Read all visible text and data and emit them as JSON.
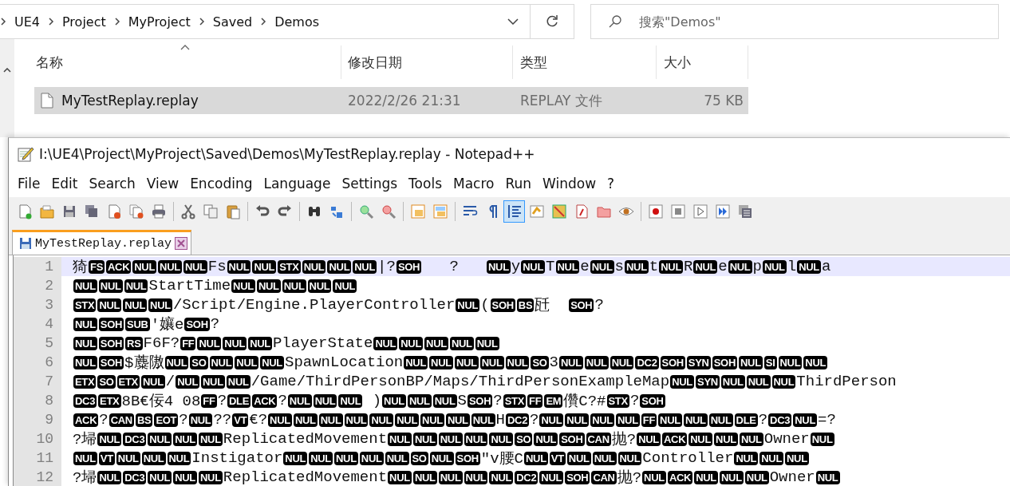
{
  "explorer": {
    "breadcrumbs": [
      "UE4",
      "Project",
      "MyProject",
      "Saved",
      "Demos"
    ],
    "search": {
      "placeholder": "搜索\"Demos\""
    },
    "columns": [
      {
        "label": "名称",
        "sorted": true
      },
      {
        "label": "修改日期",
        "sorted": false
      },
      {
        "label": "类型",
        "sorted": false
      },
      {
        "label": "大小",
        "sorted": false
      }
    ],
    "files": [
      {
        "name": "MyTestReplay.replay",
        "modified": "2022/2/26 21:31",
        "type": "REPLAY 文件",
        "size": "75 KB",
        "selected": true
      }
    ]
  },
  "notepad": {
    "title": "I:\\UE4\\Project\\MyProject\\Saved\\Demos\\MyTestReplay.replay - Notepad++",
    "menu": [
      "File",
      "Edit",
      "Search",
      "View",
      "Encoding",
      "Language",
      "Settings",
      "Tools",
      "Macro",
      "Run",
      "Window",
      "?"
    ],
    "toolbar": [
      {
        "buttons": [
          {
            "on": false
          },
          {
            "on": false
          },
          {
            "on": false
          },
          {
            "on": false
          },
          {
            "on": false
          },
          {
            "on": false
          },
          {
            "on": false
          }
        ]
      },
      {
        "buttons": [
          {
            "on": false
          },
          {
            "on": false
          },
          {
            "on": false
          }
        ]
      },
      {
        "buttons": [
          {
            "on": false
          },
          {
            "on": false
          }
        ]
      },
      {
        "buttons": [
          {
            "on": false
          },
          {
            "on": false
          }
        ]
      },
      {
        "buttons": [
          {
            "on": false
          },
          {
            "on": false
          }
        ]
      },
      {
        "buttons": [
          {
            "on": false
          },
          {
            "on": false
          }
        ]
      },
      {
        "buttons": [
          {
            "on": false
          },
          {
            "on": false
          },
          {
            "on": true
          },
          {
            "on": false
          },
          {
            "on": false
          },
          {
            "on": false
          },
          {
            "on": false
          },
          {
            "on": false
          }
        ]
      },
      {
        "buttons": [
          {
            "on": false
          },
          {
            "on": false
          },
          {
            "on": false
          },
          {
            "on": false
          },
          {
            "on": false
          }
        ]
      }
    ],
    "tabs": [
      {
        "label": "MyTestReplay.replay",
        "selected": true
      }
    ],
    "lines": [
      {
        "number": "1",
        "current": true,
        "segments": [
          {
            "kind": "text",
            "text": "猗"
          },
          {
            "kind": "ctrl",
            "text": "FS"
          },
          {
            "kind": "ctrl",
            "text": "ACK"
          },
          {
            "kind": "ctrl",
            "text": "NUL"
          },
          {
            "kind": "ctrl",
            "text": "NUL"
          },
          {
            "kind": "ctrl",
            "text": "NUL"
          },
          {
            "kind": "text",
            "text": "Fs"
          },
          {
            "kind": "ctrl",
            "text": "NUL"
          },
          {
            "kind": "ctrl",
            "text": "NUL"
          },
          {
            "kind": "ctrl",
            "text": "STX"
          },
          {
            "kind": "ctrl",
            "text": "NUL"
          },
          {
            "kind": "ctrl",
            "text": "NUL"
          },
          {
            "kind": "ctrl",
            "text": "NUL"
          },
          {
            "kind": "text",
            "text": "|?"
          },
          {
            "kind": "ctrl",
            "text": "SOH"
          },
          {
            "kind": "text",
            "text": "   ?   "
          },
          {
            "kind": "ctrl",
            "text": "NUL"
          },
          {
            "kind": "text",
            "text": "y"
          },
          {
            "kind": "ctrl",
            "text": "NUL"
          },
          {
            "kind": "text",
            "text": "T"
          },
          {
            "kind": "ctrl",
            "text": "NUL"
          },
          {
            "kind": "text",
            "text": "e"
          },
          {
            "kind": "ctrl",
            "text": "NUL"
          },
          {
            "kind": "text",
            "text": "s"
          },
          {
            "kind": "ctrl",
            "text": "NUL"
          },
          {
            "kind": "text",
            "text": "t"
          },
          {
            "kind": "ctrl",
            "text": "NUL"
          },
          {
            "kind": "text",
            "text": "R"
          },
          {
            "kind": "ctrl",
            "text": "NUL"
          },
          {
            "kind": "text",
            "text": "e"
          },
          {
            "kind": "ctrl",
            "text": "NUL"
          },
          {
            "kind": "text",
            "text": "p"
          },
          {
            "kind": "ctrl",
            "text": "NUL"
          },
          {
            "kind": "text",
            "text": "l"
          },
          {
            "kind": "ctrl",
            "text": "NUL"
          },
          {
            "kind": "text",
            "text": "a"
          }
        ]
      },
      {
        "number": "2",
        "current": false,
        "segments": [
          {
            "kind": "ctrl",
            "text": "NUL"
          },
          {
            "kind": "ctrl",
            "text": "NUL"
          },
          {
            "kind": "ctrl",
            "text": "NUL"
          },
          {
            "kind": "text",
            "text": "StartTime"
          },
          {
            "kind": "ctrl",
            "text": "NUL"
          },
          {
            "kind": "ctrl",
            "text": "NUL"
          },
          {
            "kind": "ctrl",
            "text": "NUL"
          },
          {
            "kind": "ctrl",
            "text": "NUL"
          },
          {
            "kind": "ctrl",
            "text": "NUL"
          }
        ]
      },
      {
        "number": "3",
        "current": false,
        "segments": [
          {
            "kind": "ctrl",
            "text": "STX"
          },
          {
            "kind": "ctrl",
            "text": "NUL"
          },
          {
            "kind": "ctrl",
            "text": "NUL"
          },
          {
            "kind": "ctrl",
            "text": "NUL"
          },
          {
            "kind": "text",
            "text": "/Script/Engine.PlayerController"
          },
          {
            "kind": "ctrl",
            "text": "NUL"
          },
          {
            "kind": "text",
            "text": "("
          },
          {
            "kind": "ctrl",
            "text": "SOH"
          },
          {
            "kind": "ctrl",
            "text": "BS"
          },
          {
            "kind": "text",
            "text": "瓩  "
          },
          {
            "kind": "ctrl",
            "text": "SOH"
          },
          {
            "kind": "text",
            "text": "?"
          }
        ]
      },
      {
        "number": "4",
        "current": false,
        "segments": [
          {
            "kind": "ctrl",
            "text": "NUL"
          },
          {
            "kind": "ctrl",
            "text": "SOH"
          },
          {
            "kind": "ctrl",
            "text": "SUB"
          },
          {
            "kind": "text",
            "text": "'孃e"
          },
          {
            "kind": "ctrl",
            "text": "SOH"
          },
          {
            "kind": "text",
            "text": "?"
          }
        ]
      },
      {
        "number": "5",
        "current": false,
        "segments": [
          {
            "kind": "ctrl",
            "text": "NUL"
          },
          {
            "kind": "ctrl",
            "text": "SOH"
          },
          {
            "kind": "ctrl",
            "text": "RS"
          },
          {
            "kind": "text",
            "text": "F6F?"
          },
          {
            "kind": "ctrl",
            "text": "FF"
          },
          {
            "kind": "ctrl",
            "text": "NUL"
          },
          {
            "kind": "ctrl",
            "text": "NUL"
          },
          {
            "kind": "ctrl",
            "text": "NUL"
          },
          {
            "kind": "text",
            "text": "PlayerState"
          },
          {
            "kind": "ctrl",
            "text": "NUL"
          },
          {
            "kind": "ctrl",
            "text": "NUL"
          },
          {
            "kind": "ctrl",
            "text": "NUL"
          },
          {
            "kind": "ctrl",
            "text": "NUL"
          },
          {
            "kind": "ctrl",
            "text": "NUL"
          }
        ]
      },
      {
        "number": "6",
        "current": false,
        "segments": [
          {
            "kind": "ctrl",
            "text": "NUL"
          },
          {
            "kind": "ctrl",
            "text": "SOH"
          },
          {
            "kind": "text",
            "text": "$蘪隞"
          },
          {
            "kind": "ctrl",
            "text": "NUL"
          },
          {
            "kind": "ctrl",
            "text": "SO"
          },
          {
            "kind": "ctrl",
            "text": "NUL"
          },
          {
            "kind": "ctrl",
            "text": "NUL"
          },
          {
            "kind": "ctrl",
            "text": "NUL"
          },
          {
            "kind": "text",
            "text": "SpawnLocation"
          },
          {
            "kind": "ctrl",
            "text": "NUL"
          },
          {
            "kind": "ctrl",
            "text": "NUL"
          },
          {
            "kind": "ctrl",
            "text": "NUL"
          },
          {
            "kind": "ctrl",
            "text": "NUL"
          },
          {
            "kind": "ctrl",
            "text": "NUL"
          },
          {
            "kind": "ctrl",
            "text": "SO"
          },
          {
            "kind": "text",
            "text": "3"
          },
          {
            "kind": "ctrl",
            "text": "NUL"
          },
          {
            "kind": "ctrl",
            "text": "NUL"
          },
          {
            "kind": "ctrl",
            "text": "NUL"
          },
          {
            "kind": "ctrl",
            "text": "DC2"
          },
          {
            "kind": "ctrl",
            "text": "SOH"
          },
          {
            "kind": "ctrl",
            "text": "SYN"
          },
          {
            "kind": "ctrl",
            "text": "SOH"
          },
          {
            "kind": "ctrl",
            "text": "NUL"
          },
          {
            "kind": "ctrl",
            "text": "SI"
          },
          {
            "kind": "ctrl",
            "text": "NUL"
          },
          {
            "kind": "ctrl",
            "text": "NUL"
          }
        ]
      },
      {
        "number": "7",
        "current": false,
        "segments": [
          {
            "kind": "ctrl",
            "text": "ETX"
          },
          {
            "kind": "ctrl",
            "text": "SO"
          },
          {
            "kind": "ctrl",
            "text": "ETX"
          },
          {
            "kind": "ctrl",
            "text": "NUL"
          },
          {
            "kind": "text",
            "text": "/"
          },
          {
            "kind": "ctrl",
            "text": "NUL"
          },
          {
            "kind": "ctrl",
            "text": "NUL"
          },
          {
            "kind": "ctrl",
            "text": "NUL"
          },
          {
            "kind": "text",
            "text": "/Game/ThirdPersonBP/Maps/ThirdPersonExampleMap"
          },
          {
            "kind": "ctrl",
            "text": "NUL"
          },
          {
            "kind": "ctrl",
            "text": "SYN"
          },
          {
            "kind": "ctrl",
            "text": "NUL"
          },
          {
            "kind": "ctrl",
            "text": "NUL"
          },
          {
            "kind": "ctrl",
            "text": "NUL"
          },
          {
            "kind": "text",
            "text": "ThirdPerson"
          }
        ]
      },
      {
        "number": "8",
        "current": false,
        "segments": [
          {
            "kind": "ctrl",
            "text": "DC3"
          },
          {
            "kind": "ctrl",
            "text": "ETX"
          },
          {
            "kind": "text",
            "text": "8B€佞4 08"
          },
          {
            "kind": "ctrl",
            "text": "FF"
          },
          {
            "kind": "text",
            "text": "?"
          },
          {
            "kind": "ctrl",
            "text": "DLE"
          },
          {
            "kind": "ctrl",
            "text": "ACK"
          },
          {
            "kind": "text",
            "text": "?"
          },
          {
            "kind": "ctrl",
            "text": "NUL"
          },
          {
            "kind": "ctrl",
            "text": "NUL"
          },
          {
            "kind": "ctrl",
            "text": "NUL"
          },
          {
            "kind": "text",
            "text": " )"
          },
          {
            "kind": "ctrl",
            "text": "NUL"
          },
          {
            "kind": "ctrl",
            "text": "NUL"
          },
          {
            "kind": "ctrl",
            "text": "NUL"
          },
          {
            "kind": "text",
            "text": "S"
          },
          {
            "kind": "ctrl",
            "text": "SOH"
          },
          {
            "kind": "text",
            "text": "?"
          },
          {
            "kind": "ctrl",
            "text": "STX"
          },
          {
            "kind": "ctrl",
            "text": "FF"
          },
          {
            "kind": "ctrl",
            "text": "EM"
          },
          {
            "kind": "text",
            "text": "儹C?#"
          },
          {
            "kind": "ctrl",
            "text": "STX"
          },
          {
            "kind": "text",
            "text": "?"
          },
          {
            "kind": "ctrl",
            "text": "SOH"
          }
        ]
      },
      {
        "number": "9",
        "current": false,
        "segments": [
          {
            "kind": "ctrl",
            "text": "ACK"
          },
          {
            "kind": "text",
            "text": "?"
          },
          {
            "kind": "ctrl",
            "text": "CAN"
          },
          {
            "kind": "ctrl",
            "text": "BS"
          },
          {
            "kind": "ctrl",
            "text": "EOT"
          },
          {
            "kind": "text",
            "text": "?"
          },
          {
            "kind": "ctrl",
            "text": "NUL"
          },
          {
            "kind": "text",
            "text": "??"
          },
          {
            "kind": "ctrl",
            "text": "VT"
          },
          {
            "kind": "text",
            "text": "€?"
          },
          {
            "kind": "ctrl",
            "text": "NUL"
          },
          {
            "kind": "ctrl",
            "text": "NUL"
          },
          {
            "kind": "ctrl",
            "text": "NUL"
          },
          {
            "kind": "ctrl",
            "text": "NUL"
          },
          {
            "kind": "ctrl",
            "text": "NUL"
          },
          {
            "kind": "ctrl",
            "text": "NUL"
          },
          {
            "kind": "ctrl",
            "text": "NUL"
          },
          {
            "kind": "ctrl",
            "text": "NUL"
          },
          {
            "kind": "ctrl",
            "text": "NUL"
          },
          {
            "kind": "text",
            "text": "H"
          },
          {
            "kind": "ctrl",
            "text": "DC2"
          },
          {
            "kind": "text",
            "text": "?"
          },
          {
            "kind": "ctrl",
            "text": "NUL"
          },
          {
            "kind": "ctrl",
            "text": "NUL"
          },
          {
            "kind": "ctrl",
            "text": "NUL"
          },
          {
            "kind": "ctrl",
            "text": "NUL"
          },
          {
            "kind": "ctrl",
            "text": "FF"
          },
          {
            "kind": "ctrl",
            "text": "NUL"
          },
          {
            "kind": "ctrl",
            "text": "NUL"
          },
          {
            "kind": "ctrl",
            "text": "NUL"
          },
          {
            "kind": "ctrl",
            "text": "DLE"
          },
          {
            "kind": "text",
            "text": "?"
          },
          {
            "kind": "ctrl",
            "text": "DC3"
          },
          {
            "kind": "ctrl",
            "text": "NUL"
          },
          {
            "kind": "text",
            "text": "=?"
          }
        ]
      },
      {
        "number": "10",
        "current": false,
        "segments": [
          {
            "kind": "text",
            "text": "?埽"
          },
          {
            "kind": "ctrl",
            "text": "NUL"
          },
          {
            "kind": "ctrl",
            "text": "DC3"
          },
          {
            "kind": "ctrl",
            "text": "NUL"
          },
          {
            "kind": "ctrl",
            "text": "NUL"
          },
          {
            "kind": "ctrl",
            "text": "NUL"
          },
          {
            "kind": "text",
            "text": "ReplicatedMovement"
          },
          {
            "kind": "ctrl",
            "text": "NUL"
          },
          {
            "kind": "ctrl",
            "text": "NUL"
          },
          {
            "kind": "ctrl",
            "text": "NUL"
          },
          {
            "kind": "ctrl",
            "text": "NUL"
          },
          {
            "kind": "ctrl",
            "text": "NUL"
          },
          {
            "kind": "ctrl",
            "text": "SO"
          },
          {
            "kind": "ctrl",
            "text": "NUL"
          },
          {
            "kind": "ctrl",
            "text": "SOH"
          },
          {
            "kind": "ctrl",
            "text": "CAN"
          },
          {
            "kind": "text",
            "text": "抛?"
          },
          {
            "kind": "ctrl",
            "text": "NUL"
          },
          {
            "kind": "ctrl",
            "text": "ACK"
          },
          {
            "kind": "ctrl",
            "text": "NUL"
          },
          {
            "kind": "ctrl",
            "text": "NUL"
          },
          {
            "kind": "ctrl",
            "text": "NUL"
          },
          {
            "kind": "text",
            "text": "Owner"
          },
          {
            "kind": "ctrl",
            "text": "NUL"
          }
        ]
      },
      {
        "number": "11",
        "current": false,
        "segments": [
          {
            "kind": "ctrl",
            "text": "NUL"
          },
          {
            "kind": "ctrl",
            "text": "VT"
          },
          {
            "kind": "ctrl",
            "text": "NUL"
          },
          {
            "kind": "ctrl",
            "text": "NUL"
          },
          {
            "kind": "ctrl",
            "text": "NUL"
          },
          {
            "kind": "text",
            "text": "Instigator"
          },
          {
            "kind": "ctrl",
            "text": "NUL"
          },
          {
            "kind": "ctrl",
            "text": "NUL"
          },
          {
            "kind": "ctrl",
            "text": "NUL"
          },
          {
            "kind": "ctrl",
            "text": "NUL"
          },
          {
            "kind": "ctrl",
            "text": "NUL"
          },
          {
            "kind": "ctrl",
            "text": "SO"
          },
          {
            "kind": "ctrl",
            "text": "NUL"
          },
          {
            "kind": "ctrl",
            "text": "SOH"
          },
          {
            "kind": "text",
            "text": "\"v腰C"
          },
          {
            "kind": "ctrl",
            "text": "NUL"
          },
          {
            "kind": "ctrl",
            "text": "VT"
          },
          {
            "kind": "ctrl",
            "text": "NUL"
          },
          {
            "kind": "ctrl",
            "text": "NUL"
          },
          {
            "kind": "ctrl",
            "text": "NUL"
          },
          {
            "kind": "text",
            "text": "Controller"
          },
          {
            "kind": "ctrl",
            "text": "NUL"
          },
          {
            "kind": "ctrl",
            "text": "NUL"
          },
          {
            "kind": "ctrl",
            "text": "NUL"
          }
        ]
      },
      {
        "number": "12",
        "current": false,
        "segments": [
          {
            "kind": "text",
            "text": "?埽"
          },
          {
            "kind": "ctrl",
            "text": "NUL"
          },
          {
            "kind": "ctrl",
            "text": "DC3"
          },
          {
            "kind": "ctrl",
            "text": "NUL"
          },
          {
            "kind": "ctrl",
            "text": "NUL"
          },
          {
            "kind": "ctrl",
            "text": "NUL"
          },
          {
            "kind": "text",
            "text": "ReplicatedMovement"
          },
          {
            "kind": "ctrl",
            "text": "NUL"
          },
          {
            "kind": "ctrl",
            "text": "NUL"
          },
          {
            "kind": "ctrl",
            "text": "NUL"
          },
          {
            "kind": "ctrl",
            "text": "NUL"
          },
          {
            "kind": "ctrl",
            "text": "NUL"
          },
          {
            "kind": "ctrl",
            "text": "DC2"
          },
          {
            "kind": "ctrl",
            "text": "NUL"
          },
          {
            "kind": "ctrl",
            "text": "SOH"
          },
          {
            "kind": "ctrl",
            "text": "CAN"
          },
          {
            "kind": "text",
            "text": "抛?"
          },
          {
            "kind": "ctrl",
            "text": "NUL"
          },
          {
            "kind": "ctrl",
            "text": "ACK"
          },
          {
            "kind": "ctrl",
            "text": "NUL"
          },
          {
            "kind": "ctrl",
            "text": "NUL"
          },
          {
            "kind": "ctrl",
            "text": "NUL"
          },
          {
            "kind": "text",
            "text": "Owner"
          },
          {
            "kind": "ctrl",
            "text": "NUL"
          }
        ]
      }
    ]
  }
}
